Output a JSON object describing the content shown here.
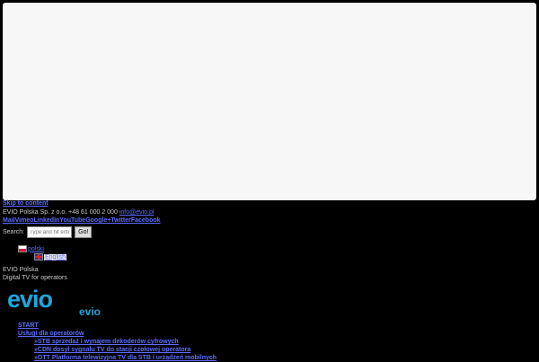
{
  "skip_link": "Skip to content",
  "company": {
    "name": "EVIO Polska Sp. z o.o.",
    "phone": "+48 61 000 2 000",
    "email": "info@evio.pl"
  },
  "social": [
    "Mail",
    "Vimeo",
    "LinkedIn",
    "YouTube",
    "Google+",
    "Twitter",
    "Facebook"
  ],
  "search": {
    "label": "Search:",
    "placeholder": "Type and hit enter...",
    "button": "Go!"
  },
  "languages": [
    "polski",
    "English"
  ],
  "site": {
    "name": "EVIO Polska",
    "tagline": "Digital TV for operators"
  },
  "logo": {
    "big": "evio",
    "small": "evio"
  },
  "nav": {
    "start": "START",
    "services": "Usługi dla operatorów",
    "sub": [
      "»STB sprzedaż i wynajem dekoderów cyfrowych",
      "»CDN dosył sygnału TV do stacji czołowej operatora",
      "»OTT Platforma telewizyjna TV dla STB i urządzeń mobilnych"
    ]
  }
}
